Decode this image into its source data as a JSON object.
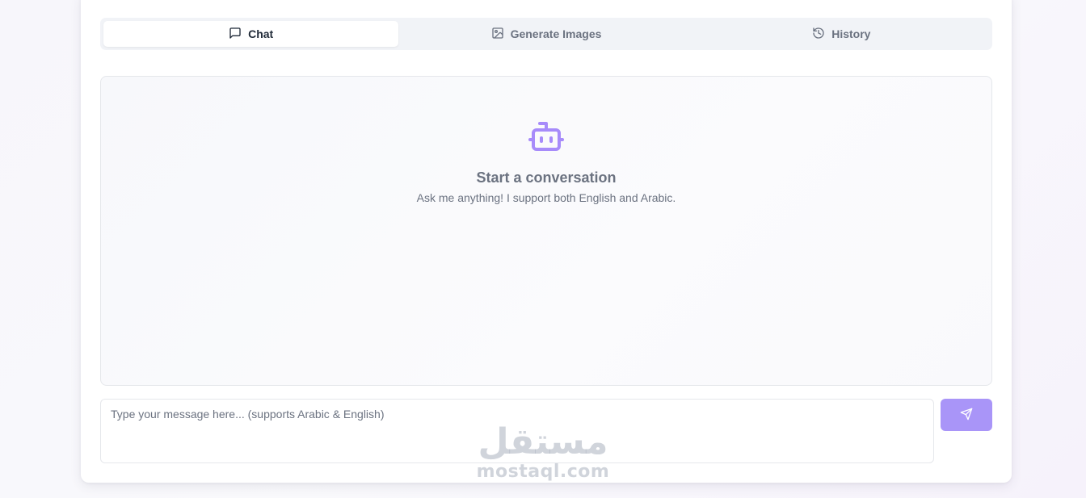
{
  "tabs": [
    {
      "label": "Chat",
      "icon": "message-square-icon",
      "active": true
    },
    {
      "label": "Generate Images",
      "icon": "image-icon",
      "active": false
    },
    {
      "label": "History",
      "icon": "history-icon",
      "active": false
    }
  ],
  "empty_state": {
    "icon": "bot-icon",
    "title": "Start a conversation",
    "subtitle": "Ask me anything! I support both English and Arabic."
  },
  "composer": {
    "placeholder": "Type your message here... (supports Arabic & English)",
    "value": "",
    "send_icon": "send-icon"
  },
  "watermark": {
    "arabic": "مستقل",
    "latin": "mostaql.com"
  },
  "colors": {
    "accent": "#a78bfa",
    "send_button": "#a995f8",
    "tab_bar": "#f1f3f7"
  }
}
